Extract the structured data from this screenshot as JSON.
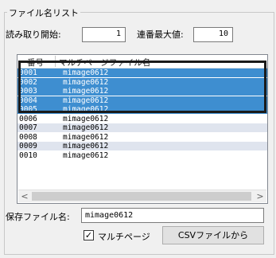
{
  "group": {
    "title": "ファイル名リスト"
  },
  "read_start": {
    "label": "読み取り開始:",
    "value": "1"
  },
  "serial_max": {
    "label": "連番最大値:",
    "value": "10"
  },
  "list": {
    "columns": [
      "番号",
      "マルチページファイル名"
    ],
    "rows": [
      {
        "num": "0001",
        "name": "mimage0612"
      },
      {
        "num": "0002",
        "name": "mimage0612"
      },
      {
        "num": "0003",
        "name": "mimage0612"
      },
      {
        "num": "0004",
        "name": "mimage0612"
      },
      {
        "num": "0005",
        "name": "mimage0612"
      },
      {
        "num": "0006",
        "name": "mimage0612"
      },
      {
        "num": "0007",
        "name": "mimage0612"
      },
      {
        "num": "0008",
        "name": "mimage0612"
      },
      {
        "num": "0009",
        "name": "mimage0612"
      },
      {
        "num": "0010",
        "name": "mimage0612"
      }
    ],
    "scroll_left": "<",
    "scroll_right": ">"
  },
  "save_name": {
    "label": "保存ファイル名:",
    "value": "mimage0612"
  },
  "multipage": {
    "label": "マルチページ",
    "checked_mark": "✓"
  },
  "csv_button": {
    "label": "CSVファイルから"
  }
}
